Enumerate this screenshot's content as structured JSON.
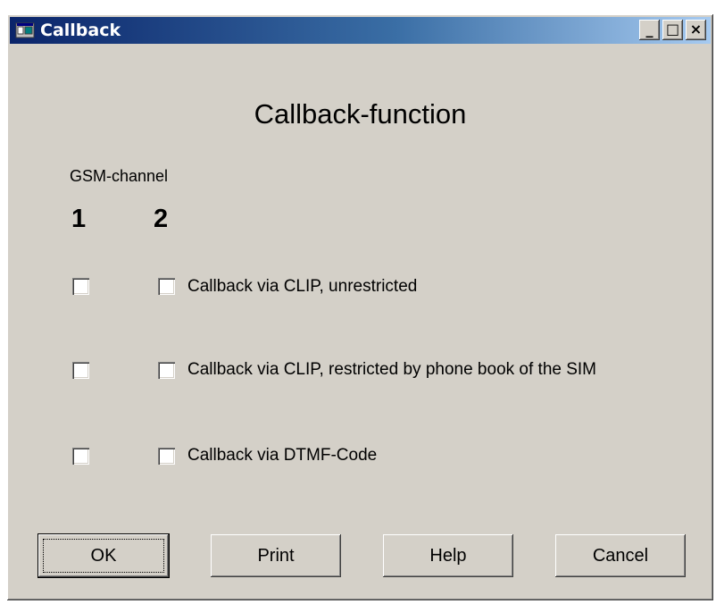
{
  "window": {
    "title": "Callback",
    "controls": {
      "minimize": "_",
      "maximize": "□",
      "close": "×"
    }
  },
  "dialog": {
    "heading": "Callback-function",
    "gsm_label": "GSM-channel",
    "channels": [
      "1",
      "2"
    ],
    "options": [
      {
        "label": "Callback via CLIP, unrestricted",
        "ch1": false,
        "ch2": false
      },
      {
        "label": "Callback via CLIP, restricted by phone book of the SIM",
        "ch1": false,
        "ch2": false
      },
      {
        "label": "Callback via DTMF-Code",
        "ch1": false,
        "ch2": false
      }
    ]
  },
  "buttons": {
    "ok": "OK",
    "print": "Print",
    "help": "Help",
    "cancel": "Cancel"
  },
  "icons": {
    "app": "app-window-icon"
  },
  "colors": {
    "face": "#d4d0c8",
    "title_start": "#0a246a",
    "title_end": "#a6caf0"
  }
}
